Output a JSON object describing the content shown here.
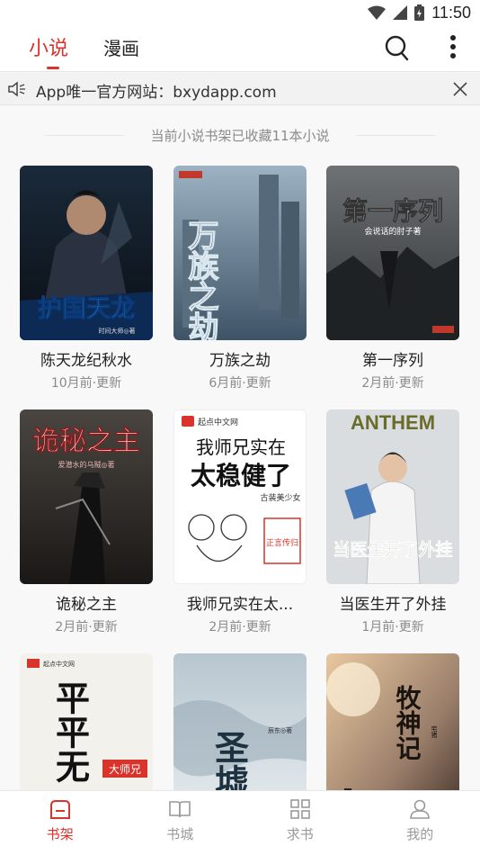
{
  "status": {
    "time": "11:50"
  },
  "header": {
    "tabs": [
      {
        "label": "小说",
        "active": true
      },
      {
        "label": "漫画",
        "active": false
      }
    ]
  },
  "notice": {
    "text": "App唯一官方网站：bxydapp.com"
  },
  "shelf": {
    "summary": "当前小说书架已收藏11本小说",
    "books": [
      {
        "title": "陈天龙纪秋水",
        "updated": "10月前·更新",
        "cover_text": "护国天龙",
        "cover_sub": "时间大师◎著"
      },
      {
        "title": "万族之劫",
        "updated": "6月前·更新",
        "cover_text": "万族之劫",
        "cover_sub": ""
      },
      {
        "title": "第一序列",
        "updated": "2月前·更新",
        "cover_text": "第一序列",
        "cover_sub": "会说话的肘子著"
      },
      {
        "title": "诡秘之主",
        "updated": "2月前·更新",
        "cover_text": "诡秘之主",
        "cover_sub": "爱潜水的乌贼◎著"
      },
      {
        "title": "我师兄实在太...",
        "updated": "2月前·更新",
        "cover_text": "我师兄实在",
        "cover_text2": "太稳健了",
        "cover_sub": "古装美少女",
        "cover_brand": "起点中文网",
        "seal": "正言传归"
      },
      {
        "title": "当医生开了外挂",
        "updated": "1月前·更新",
        "cover_text": "ANTHEM",
        "cover_text2": "当医生开了外挂"
      },
      {
        "title": "",
        "updated": "",
        "cover_text": "平平无",
        "cover_sub": "大师兄",
        "cover_brand": "起点中文网"
      },
      {
        "title": "",
        "updated": "",
        "cover_text": "圣墟",
        "cover_sub": "辰东◎著"
      },
      {
        "title": "",
        "updated": "",
        "cover_text": "牧神记",
        "cover_sub": "宅猪"
      }
    ]
  },
  "bottom_nav": [
    {
      "label": "书架",
      "icon": "bookshelf-icon",
      "active": true
    },
    {
      "label": "书城",
      "icon": "book-open-icon",
      "active": false
    },
    {
      "label": "求书",
      "icon": "grid-icon",
      "active": false
    },
    {
      "label": "我的",
      "icon": "user-icon",
      "active": false
    }
  ],
  "colors": {
    "accent": "#d9342b",
    "text": "#222222",
    "muted": "#8a8a8a"
  }
}
